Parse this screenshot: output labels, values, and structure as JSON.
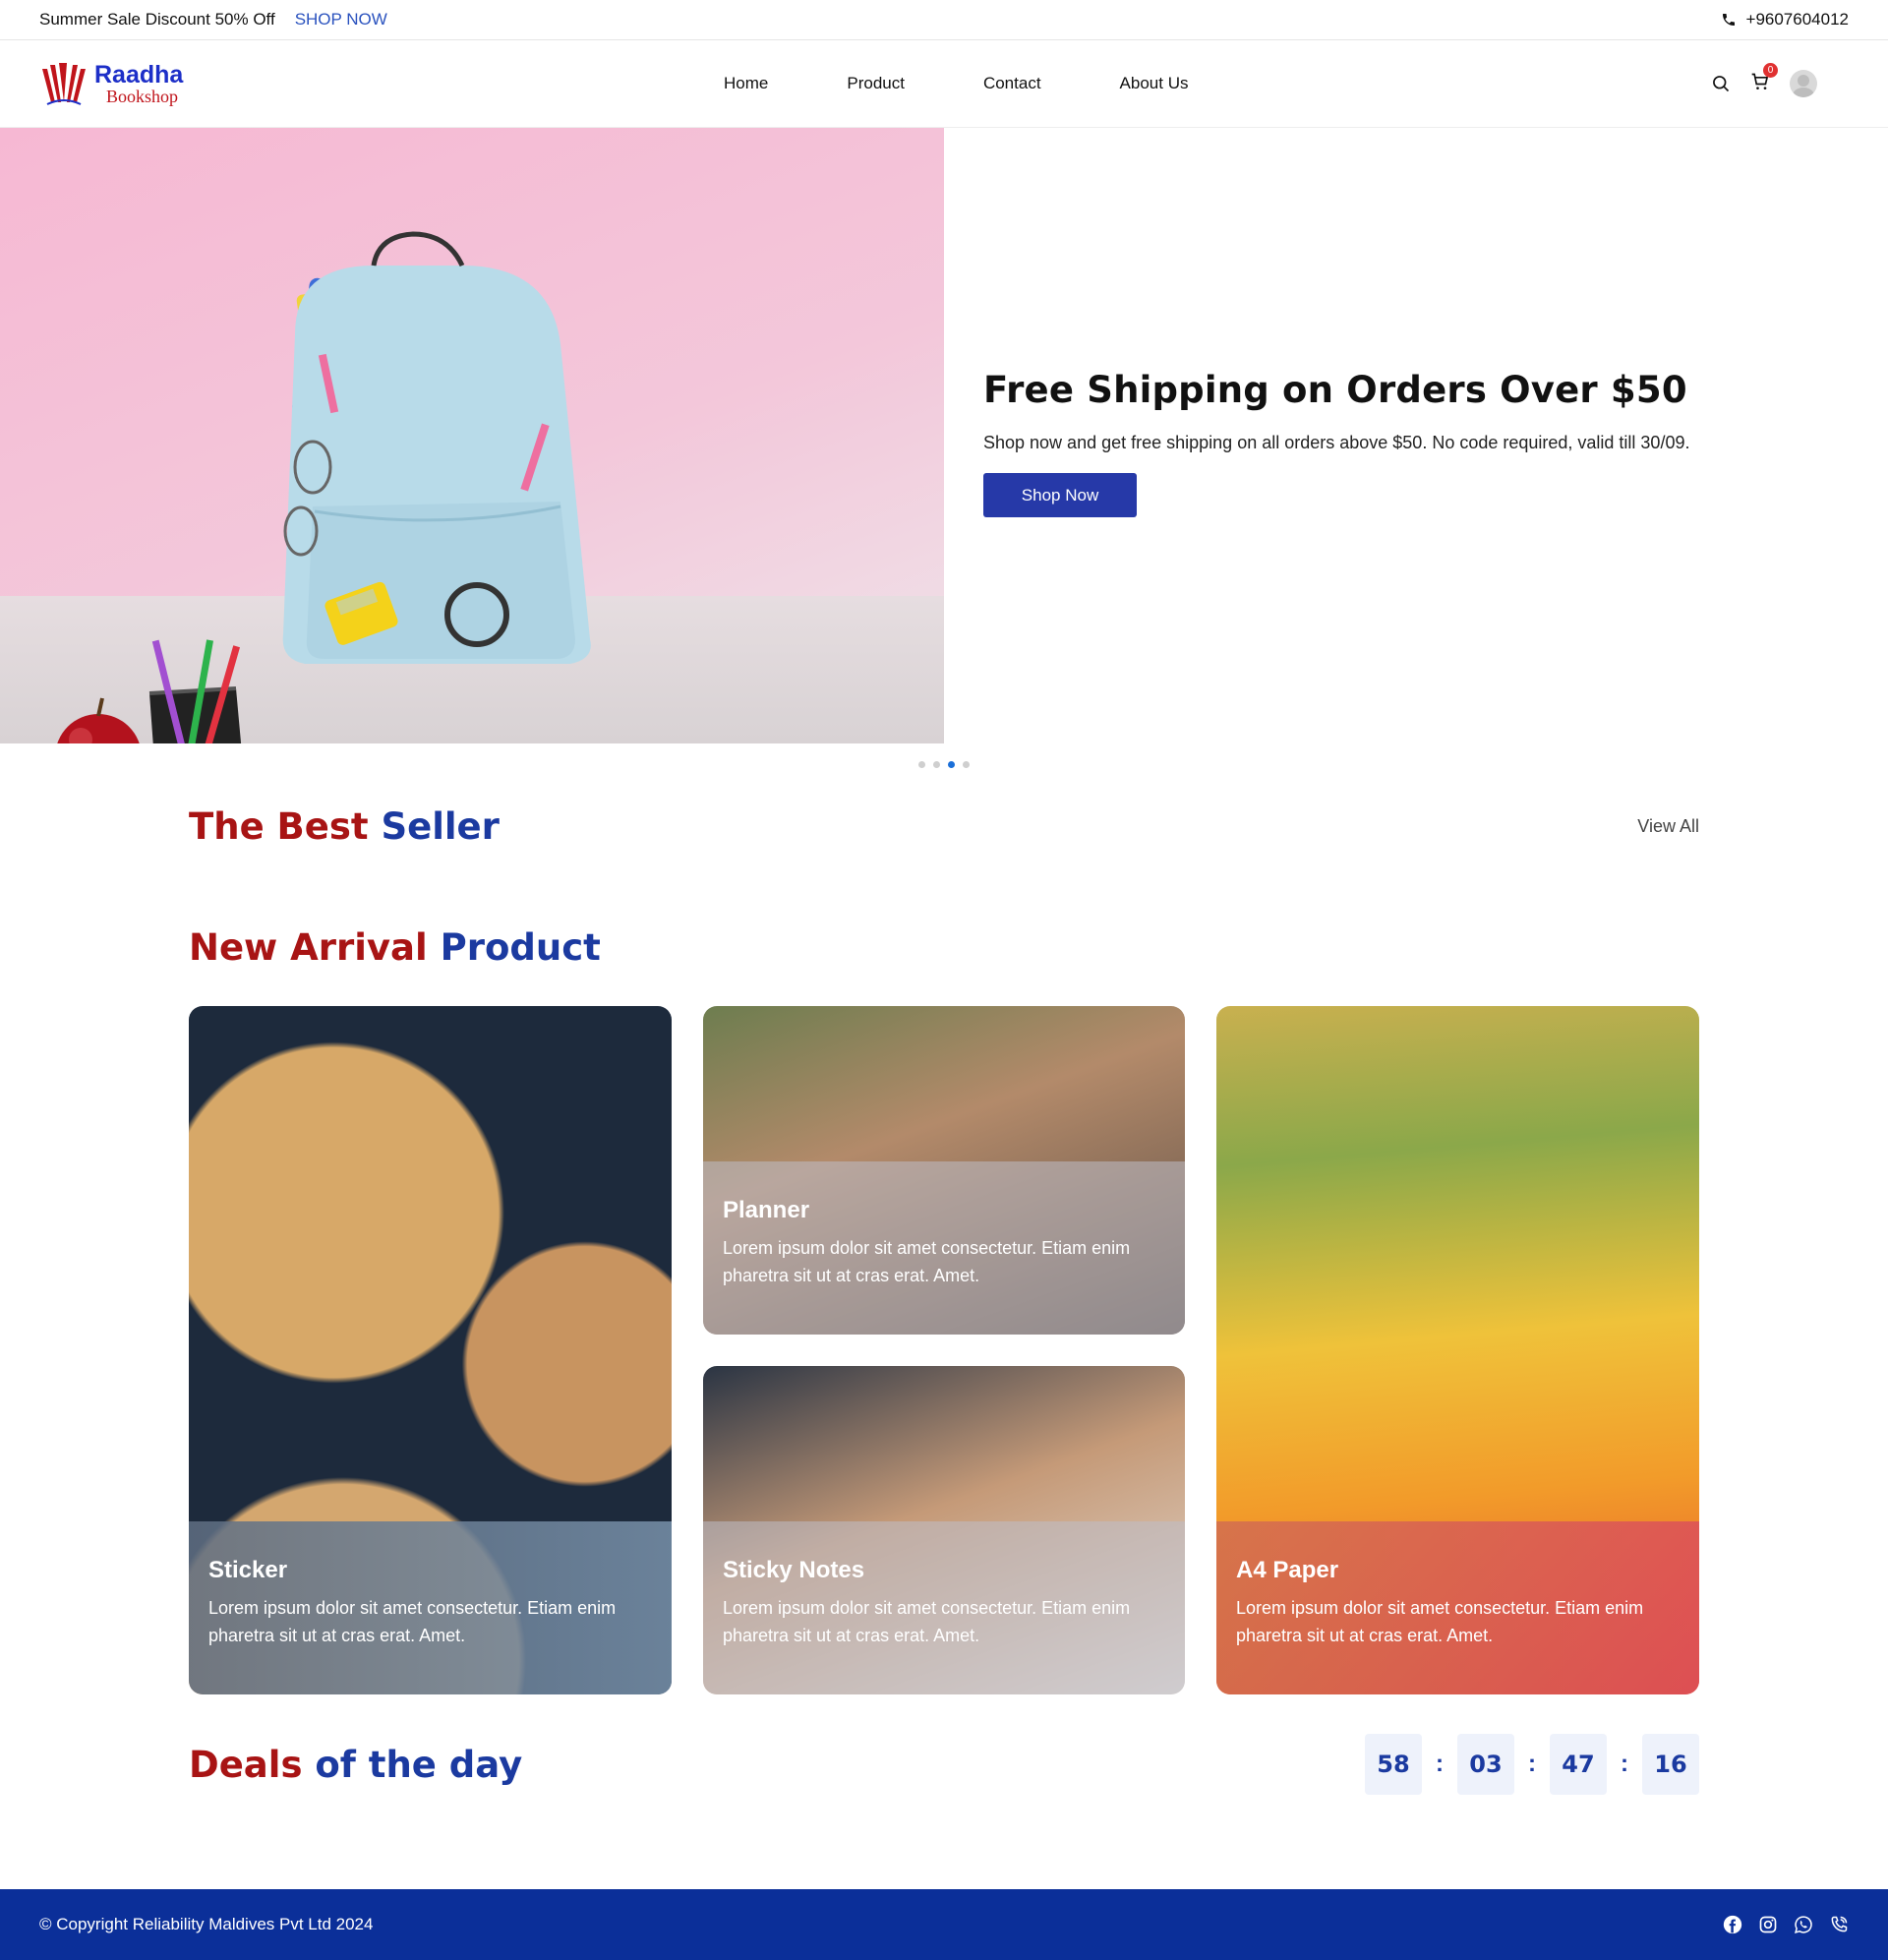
{
  "topbar": {
    "promo": "Summer Sale Discount 50% Off",
    "shop_now": "SHOP NOW",
    "phone": "+9607604012"
  },
  "header": {
    "logo_title": "Raadha",
    "logo_sub": "Bookshop",
    "nav": [
      "Home",
      "Product",
      "Contact",
      "About Us"
    ],
    "cart_count": "0"
  },
  "hero": {
    "title": "Free Shipping on Orders Over $50",
    "text": "Shop now and get free shipping on all orders above $50. No code required, valid till 30/09.",
    "button": "Shop Now",
    "slides_total": 4,
    "active_slide": 3
  },
  "best_seller": {
    "title_part1": "The Best",
    "title_part2": "Seller",
    "view_all": "View All"
  },
  "new_arrival": {
    "title_part1": "New Arrival",
    "title_part2": "Product",
    "cards": [
      {
        "title": "Sticker",
        "desc": "Lorem ipsum dolor sit amet consectetur. Etiam enim pharetra sit ut at cras erat. Amet."
      },
      {
        "title": "Planner",
        "desc": "Lorem ipsum dolor sit amet consectetur. Etiam enim pharetra sit ut at cras erat. Amet."
      },
      {
        "title": "Sticky Notes",
        "desc": "Lorem ipsum dolor sit amet consectetur. Etiam enim pharetra sit ut at cras erat. Amet."
      },
      {
        "title": "A4 Paper",
        "desc": "Lorem ipsum dolor sit amet consectetur. Etiam enim pharetra sit ut at cras erat. Amet."
      }
    ]
  },
  "deals": {
    "title_part1": "Deals",
    "title_part2": "of the day",
    "timer": [
      "58",
      "03",
      "47",
      "16"
    ],
    "separator": ":"
  },
  "footer": {
    "copyright": "© Copyright Reliability Maldives Pvt Ltd 2024",
    "socials": [
      "facebook-icon",
      "instagram-icon",
      "whatsapp-icon",
      "viber-icon"
    ]
  },
  "colors": {
    "brand_red": "#a81414",
    "brand_blue": "#1b3aa0",
    "button_blue": "#2639a8",
    "footer_blue": "#0b2f99",
    "link_blue": "#2a52be"
  }
}
